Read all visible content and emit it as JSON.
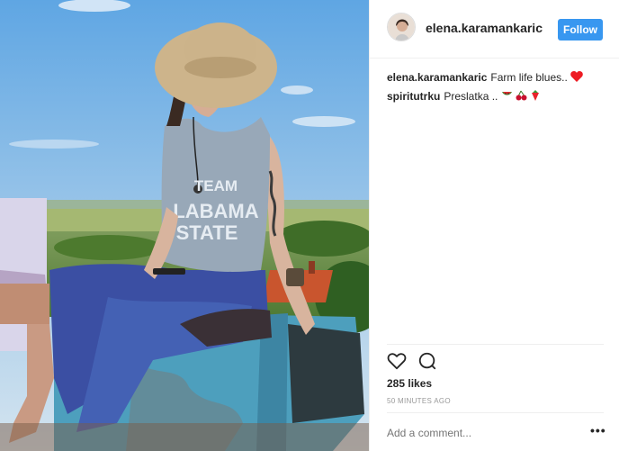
{
  "post": {
    "username": "elena.karamankaric",
    "follow_label": "Follow",
    "image": {
      "icon": "photo-woman-sitting-on-tractor-icon",
      "shirt_text_1": "TEAM",
      "shirt_text_2": "LABAMA",
      "shirt_text_3": "STATE"
    },
    "comments": [
      {
        "user": "elena.karamankaric",
        "text": "Farm life blues..",
        "emoji": "❤"
      },
      {
        "user": "spiritutrku",
        "text": "Preslatka ..",
        "emoji": "🍉🍒🍓"
      }
    ],
    "likes": "285 likes",
    "timestamp": "50 MINUTES AGO",
    "add_comment_placeholder": "Add a comment...",
    "more_options": "•••"
  },
  "colors": {
    "follow": "#3897f0",
    "heart": "#ed1c24"
  }
}
